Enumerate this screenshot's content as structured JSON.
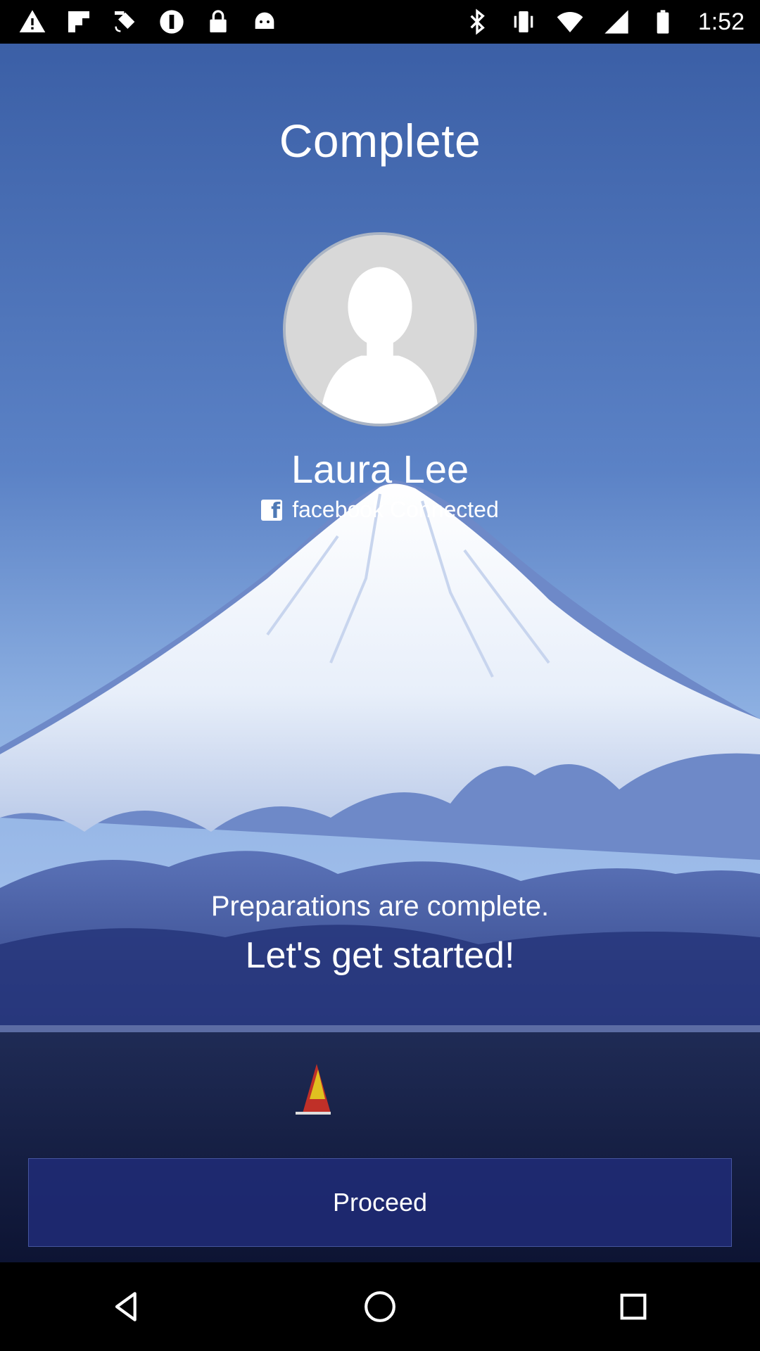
{
  "status_bar": {
    "time": "1:52",
    "left_icons": [
      "warning-icon",
      "flipboard-icon",
      "fake-gps-icon",
      "info-icon",
      "lock-icon",
      "android-icon"
    ],
    "right_icons": [
      "bluetooth-icon",
      "vibrate-icon",
      "wifi-icon",
      "signal-icon",
      "battery-icon"
    ]
  },
  "screen": {
    "title": "Complete",
    "user_name": "Laura Lee",
    "facebook_label": "facebook Connected",
    "message_line1": "Preparations are complete.",
    "message_line2": "Let's get started!",
    "proceed_label": "Proceed"
  },
  "nav_bar": {
    "buttons": [
      "back-icon",
      "home-icon",
      "recents-icon"
    ]
  },
  "colors": {
    "sky_top": "#3a5fa8",
    "sky_bottom": "#8fb0e0",
    "button_bg": "#202c78"
  }
}
